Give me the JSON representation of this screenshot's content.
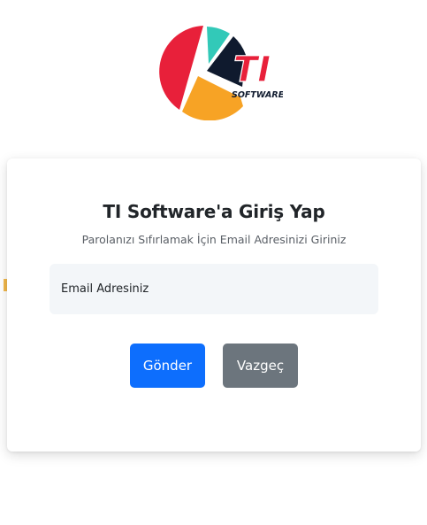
{
  "logo": {
    "text_main": "TI",
    "text_sub": "SOFTWARE",
    "colors": {
      "red": "#e8203a",
      "orange": "#f7a325",
      "teal": "#32c9b8",
      "navy": "#0f1a2e"
    }
  },
  "form": {
    "title": "TI Software'a Giriş Yap",
    "subtitle": "Parolanızı Sıfırlamak İçin Email Adresinizi Giriniz",
    "email_field": {
      "label": "Email Adresiniz",
      "value": ""
    },
    "send_label": "Gönder",
    "cancel_label": "Vazgeç"
  },
  "colors": {
    "primary": "#0d6efd",
    "secondary": "#6c757d",
    "input_bg": "#f3f6f9"
  }
}
